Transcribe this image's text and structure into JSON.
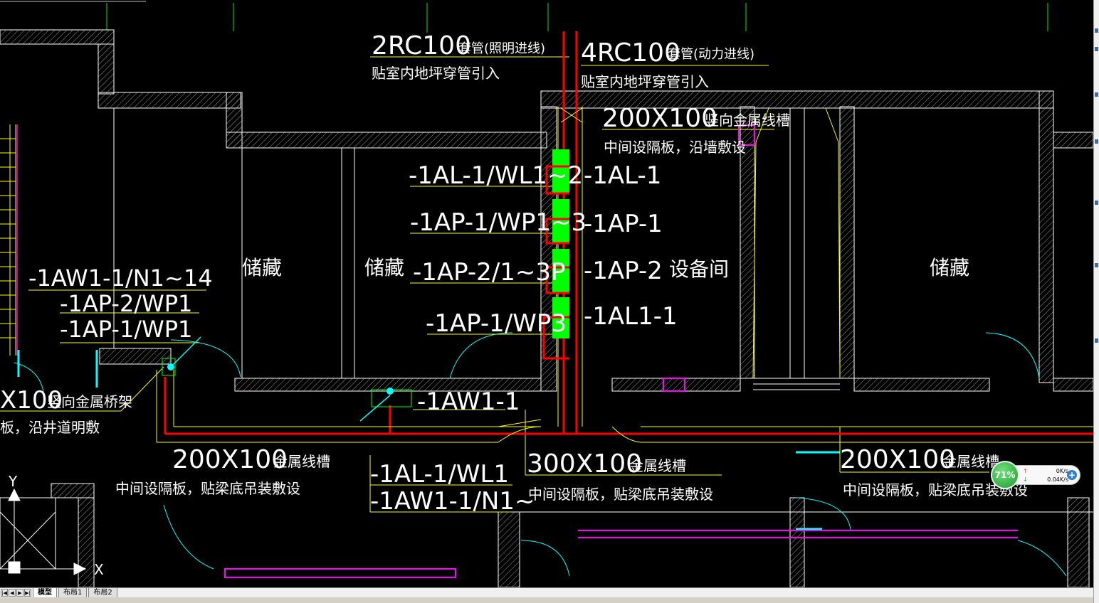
{
  "drawing": {
    "labels": {
      "conduit_lighting": "2RC100",
      "conduit_lighting_cn": "套管(照明进线)",
      "conduit_lighting_note": "贴室内地坪穿管引入",
      "conduit_power": "4RC100",
      "conduit_power_cn": "套管(动力进线)",
      "conduit_power_note": "贴室内地坪穿管引入",
      "tray_vertical_size": "200X100",
      "tray_vertical_cn": "竖向金属线槽",
      "tray_vertical_note": "中间设隔板，沿墙敷设",
      "circ_al1_wl": "-1AL-1/WL1~2",
      "circ_ap1_wp": "-1AP-1/WP1~3",
      "circ_ap2": "-1AP-2/1~3P",
      "circ_ap1_wp3": "-1AP-1/WP3",
      "panel_al1": "-1AL-1",
      "panel_ap1": "-1AP-1",
      "panel_ap2": "-1AP-2",
      "panel_al11": "-1AL1-1",
      "room_equipment": "设备间",
      "room_storage_1": "储藏",
      "room_storage_2": "储藏",
      "room_storage_3": "储藏",
      "left_aw1": "-1AW1-1/N1~14",
      "left_ap2": "-1AP-2/WP1",
      "left_ap1": "-1AP-1/WP1",
      "shaft_tray_size": "X100",
      "shaft_tray_cn": "竖向金属桥架",
      "shaft_tray_note": "板，沿井道明敷",
      "aw1_panel": "-1AW1-1",
      "tray_left_size": "200X100",
      "tray_left_cn": "金属线槽",
      "tray_left_note": "中间设隔板，贴梁底吊装敷设",
      "bottom_al1": "-1AL-1/WL1",
      "bottom_aw1": "-1AW1-1/N1~",
      "tray_mid_size": "300X100",
      "tray_mid_cn": "金属线槽",
      "tray_mid_note": "中间设隔板，贴梁底吊装敷设",
      "tray_right_size": "200X100",
      "tray_right_cn": "金属线槽",
      "tray_right_note": "中间设隔板，贴梁底吊装敷设",
      "ucs_y": "Y",
      "ucs_x": "X"
    },
    "colors": {
      "wall": "#ffffff",
      "line": "#ffff00",
      "tray": "#ff0000",
      "panel": "#00ff00",
      "door": "#00ffff",
      "marker": "#ff00ff",
      "grid": "#00c000"
    }
  },
  "tabs": [
    {
      "label": "模型",
      "active": true
    },
    {
      "label": "布局1",
      "active": false
    },
    {
      "label": "布局2",
      "active": false
    }
  ],
  "nav_buttons": [
    "|◀",
    "◀",
    "▶",
    "▶|"
  ],
  "network": {
    "percent": "71%",
    "upload": "0K/s",
    "download": "0.04K/s",
    "add": "+"
  }
}
